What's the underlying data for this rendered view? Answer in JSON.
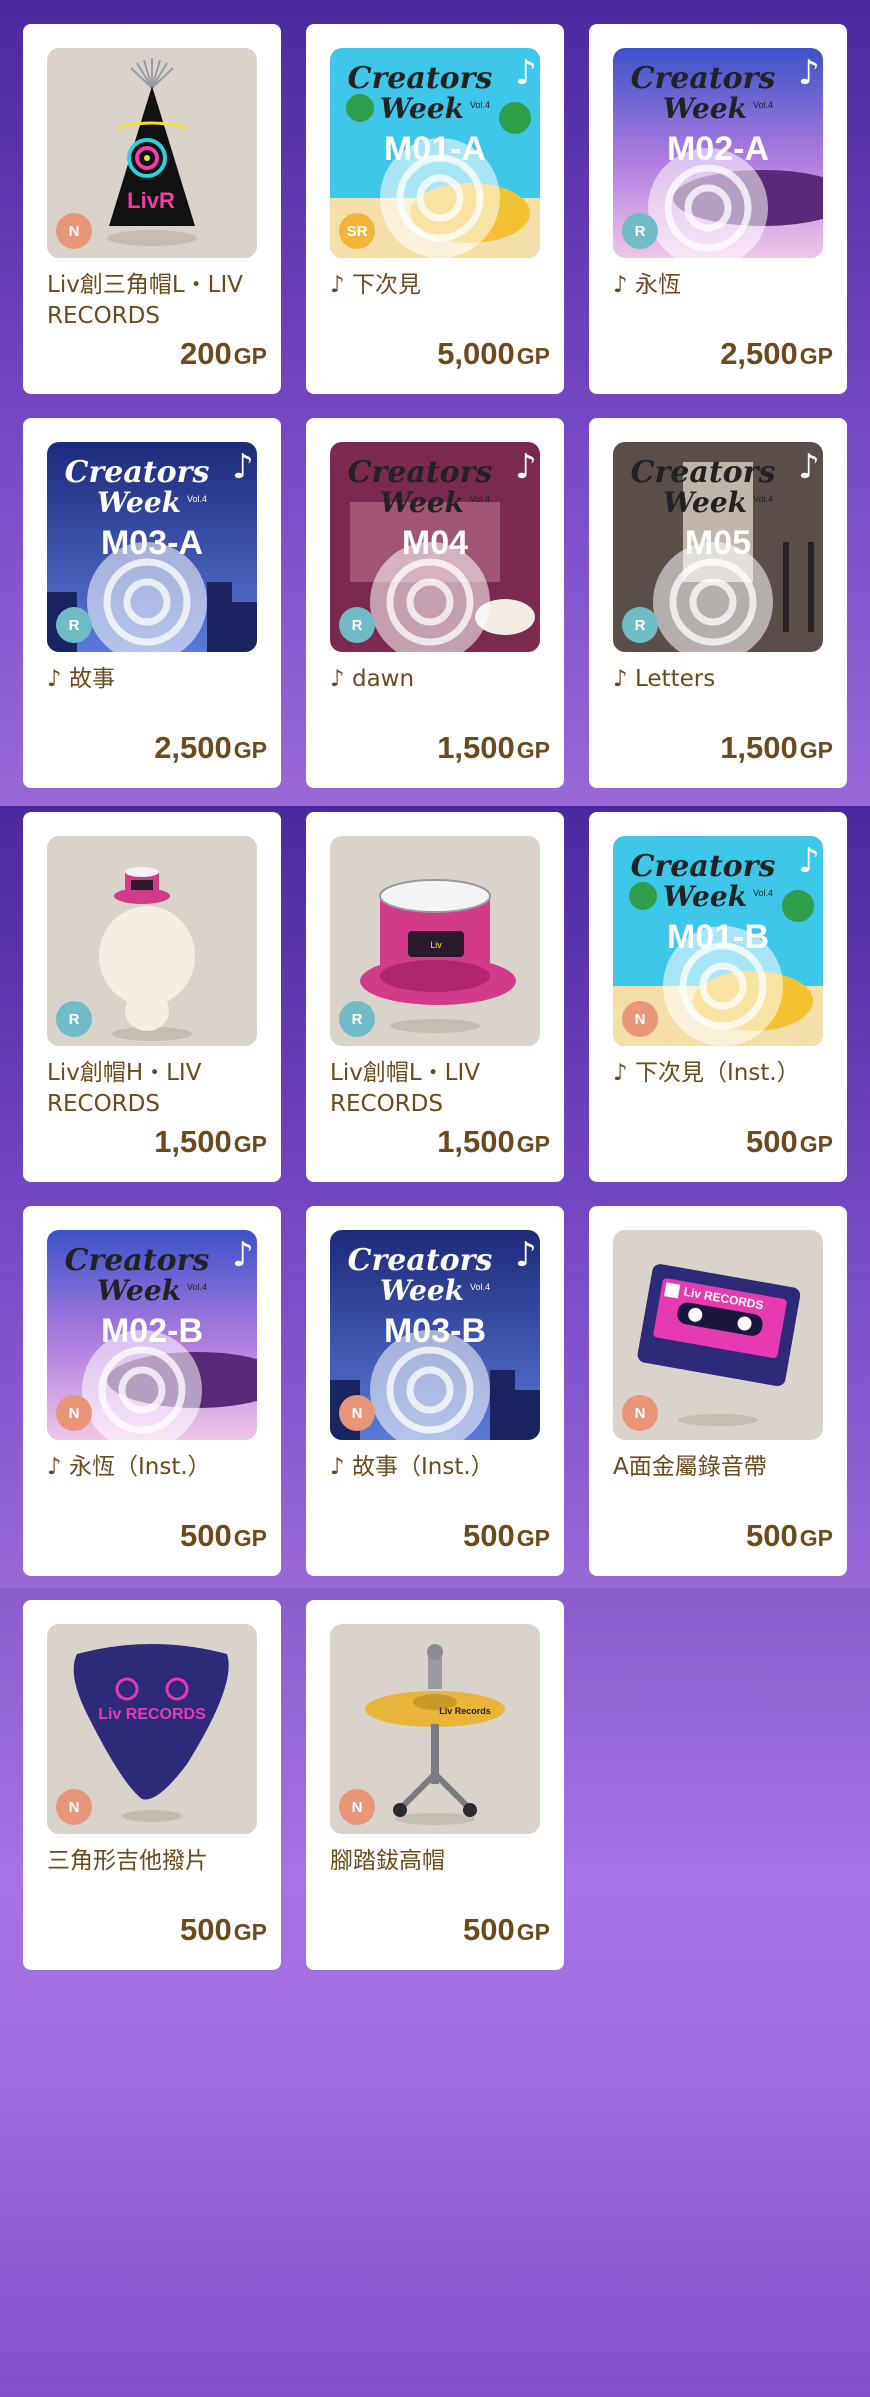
{
  "colors": {
    "rarity_N": "#e8957a",
    "rarity_R": "#6fbcc6",
    "rarity_SR": "#f2b53a",
    "text_brown": "#6b4a1e"
  },
  "items": [
    {
      "name": "Liv創三角帽L・LIV RECORDS",
      "price": "200",
      "unit": "GP",
      "rarity": "N",
      "art": "party-hat-icon"
    },
    {
      "name": "♪ 下次見",
      "price": "5,000",
      "unit": "GP",
      "rarity": "SR",
      "art": "creators-week-cover",
      "cover_text": "M01-A"
    },
    {
      "name": "♪ 永恆",
      "price": "2,500",
      "unit": "GP",
      "rarity": "R",
      "art": "creators-week-cover",
      "cover_text": "M02-A"
    },
    {
      "name": "♪ 故事",
      "price": "2,500",
      "unit": "GP",
      "rarity": "R",
      "art": "creators-week-cover",
      "cover_text": "M03-A"
    },
    {
      "name": "♪ dawn",
      "price": "1,500",
      "unit": "GP",
      "rarity": "R",
      "art": "creators-week-cover",
      "cover_text": "M04"
    },
    {
      "name": "♪ Letters",
      "price": "1,500",
      "unit": "GP",
      "rarity": "R",
      "art": "creators-week-cover",
      "cover_text": "M05"
    },
    {
      "name": "Liv創帽H・LIV RECORDS",
      "price": "1,500",
      "unit": "GP",
      "rarity": "R",
      "art": "drum-hat-avatar-icon"
    },
    {
      "name": "Liv創帽L・LIV RECORDS",
      "price": "1,500",
      "unit": "GP",
      "rarity": "R",
      "art": "drum-hat-icon"
    },
    {
      "name": "♪ 下次見（Inst.）",
      "price": "500",
      "unit": "GP",
      "rarity": "N",
      "art": "creators-week-cover",
      "cover_text": "M01-B"
    },
    {
      "name": "♪ 永恆（Inst.）",
      "price": "500",
      "unit": "GP",
      "rarity": "N",
      "art": "creators-week-cover",
      "cover_text": "M02-B"
    },
    {
      "name": "♪ 故事（Inst.）",
      "price": "500",
      "unit": "GP",
      "rarity": "N",
      "art": "creators-week-cover",
      "cover_text": "M03-B"
    },
    {
      "name": "A面金屬錄音帶",
      "price": "500",
      "unit": "GP",
      "rarity": "N",
      "art": "cassette-tape-icon",
      "art_text": "Liv RECORDS"
    },
    {
      "name": "三角形吉他撥片",
      "price": "500",
      "unit": "GP",
      "rarity": "N",
      "art": "guitar-pick-icon",
      "art_text": "Liv RECORDS"
    },
    {
      "name": "腳踏鈸高帽",
      "price": "500",
      "unit": "GP",
      "rarity": "N",
      "art": "hihat-hat-icon",
      "art_text": "Liv Records"
    }
  ],
  "cover_title_1": "Creators",
  "cover_title_2": "Week",
  "cover_vol": "Vol.4"
}
